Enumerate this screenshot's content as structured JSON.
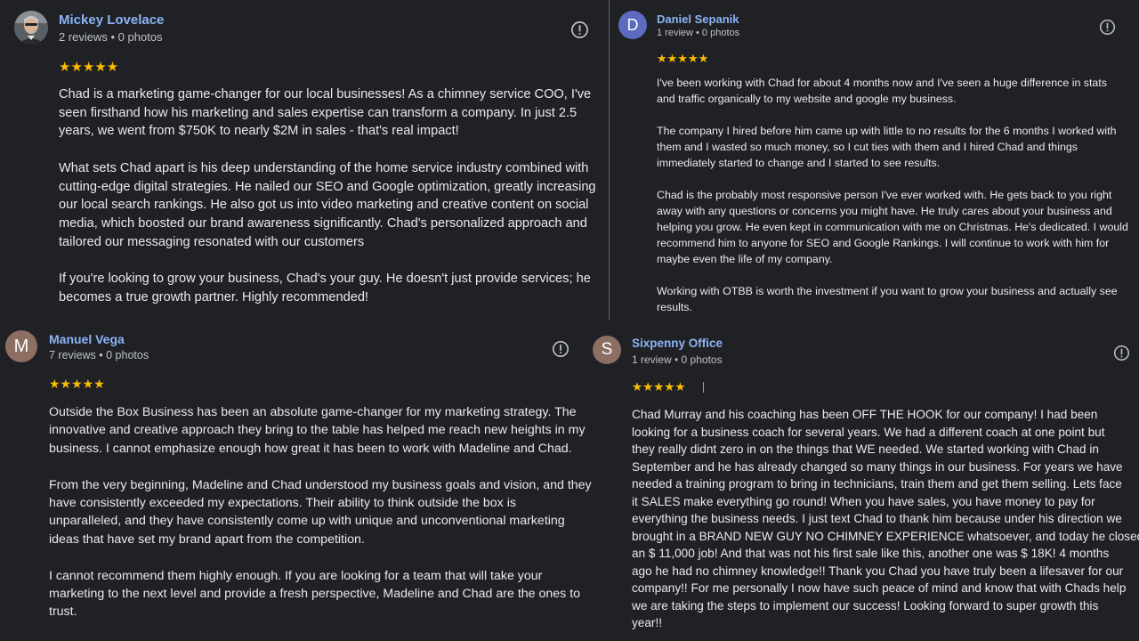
{
  "reviews": [
    {
      "name": "Mickey Lovelace",
      "meta": "2 reviews • 0 photos",
      "stars": "★★★★★",
      "paragraphs": [
        "Chad is a marketing game-changer for our local businesses! As a chimney service COO, I've seen firsthand how his marketing and sales expertise can transform a company. In just 2.5 years, we went from $750K to nearly $2M in sales - that's real impact!",
        "What sets Chad apart is his deep understanding of the home service industry combined with cutting-edge digital strategies. He nailed our SEO and Google optimization, greatly increasing our local search rankings. He also got us into video marketing and creative content on social media, which boosted our brand awareness significantly. Chad's personalized approach and tailored our messaging resonated with our customers",
        "If you're looking to grow your business, Chad's your guy. He doesn't just provide services; he becomes a true growth partner. Highly recommended!"
      ]
    },
    {
      "name": "Daniel Sepanik",
      "initial": "D",
      "meta": "1 review • 0 photos",
      "stars": "★★★★★",
      "paragraphs": [
        "I've been working with Chad for about 4 months now and I've seen a huge difference in stats and traffic organically to my website and google my business.",
        "The company I hired before him came up with little to no results for the 6 months I worked with them and I wasted so much money, so I cut ties with them and I hired Chad and things immediately started to change and I started to see results.",
        "Chad is the probably most responsive person I've ever worked with. He gets back to you right away with any questions or concerns you might have. He truly cares about your business and helping you grow. He even kept in communication with me on Christmas. He's dedicated. I would recommend him to anyone for SEO and Google Rankings. I will continue to work with him for maybe even the life of my company.",
        "Working with OTBB is worth the investment if you want to grow your business and actually see results."
      ]
    },
    {
      "name": "Manuel Vega",
      "initial": "M",
      "meta": "7 reviews • 0 photos",
      "stars": "★★★★★",
      "paragraphs": [
        "Outside the Box Business has been an absolute game-changer for my marketing strategy. The innovative and creative approach they bring to the table has helped me reach new heights in my business. I cannot emphasize enough how great it has been to work with Madeline and Chad.",
        "From the very beginning, Madeline and Chad understood my business goals and vision, and they have consistently exceeded my expectations. Their ability to think outside the box is unparalleled, and they have consistently come up with unique and unconventional marketing ideas that have set my brand apart from the competition.",
        "I cannot recommend them highly enough. If you are looking for a team that will take your marketing to the next level and provide a fresh perspective, Madeline and Chad are the ones to trust."
      ]
    },
    {
      "name": "Sixpenny Office",
      "initial": "S",
      "meta": "1 review • 0 photos",
      "stars": "★★★★★",
      "lines": [
        "Chad Murray and his coaching has been OFF THE HOOK for our company! I had been",
        "looking for a business coach for several years. We had a different coach at one point but",
        "they really didnt zero in on the things that WE needed. We started working with Chad in",
        "September and he has already changed so many things in our business. For years we have",
        "needed a training program to bring in technicians, train them and get them selling. Lets face",
        "it SALES make everything go round! When you have sales, you have money to pay for",
        "everything the business needs. I just text Chad to thank him because under his direction we",
        "brought in a BRAND NEW GUY NO CHIMNEY EXPERIENCE whatsoever, and today he closed",
        "an $ 11,000 job! And that was not his first sale like this, another one was $ 18K! 4 months",
        "ago he had no chimney knowledge!! Thank you Chad you have truly been a lifesaver for our",
        "company!! For me personally I now have such peace of mind and know that with Chads help",
        "we are taking the steps to implement our success! Looking forward to super growth this",
        "year!!"
      ]
    }
  ]
}
